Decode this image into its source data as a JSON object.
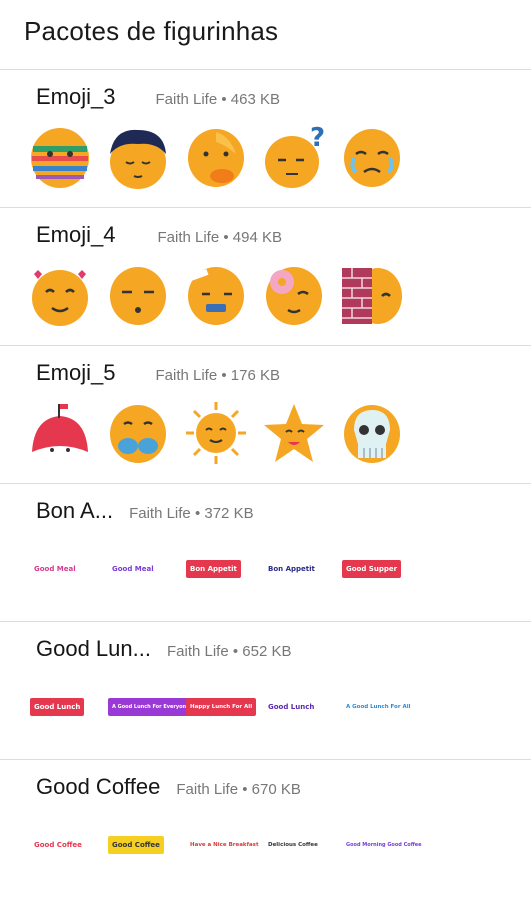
{
  "header": {
    "title": "Pacotes de figurinhas"
  },
  "colors": {
    "emoji_face": "#f5a623",
    "divider": "#dddddd",
    "meta_text": "#777777"
  },
  "packs": [
    {
      "name": "Emoji_3",
      "publisher": "Faith Life",
      "size": "463 KB",
      "stickers": [
        "emoji-easter-egg",
        "emoji-hair",
        "emoji-duck-beak",
        "emoji-question",
        "emoji-crying"
      ]
    },
    {
      "name": "Emoji_4",
      "publisher": "Faith Life",
      "size": "494 KB",
      "stickers": [
        "emoji-hearts",
        "emoji-sleepy",
        "emoji-bandage",
        "emoji-donut",
        "emoji-brick-wall"
      ]
    },
    {
      "name": "Emoji_5",
      "publisher": "Faith Life",
      "size": "176 KB",
      "stickers": [
        "emoji-cake",
        "emoji-bikini",
        "emoji-sun",
        "emoji-star",
        "emoji-skull"
      ]
    },
    {
      "name": "Bon A...",
      "publisher": "Faith Life",
      "size": "372 KB",
      "stickers": [
        "Good Meal",
        "Good Meal",
        "Bon Appetit",
        "Bon Appetit",
        "Good Supper"
      ]
    },
    {
      "name": "Good Lun...",
      "publisher": "Faith Life",
      "size": "652 KB",
      "stickers": [
        "Good Lunch",
        "A Good Lunch For Everyone",
        "Happy Lunch For All",
        "Good Lunch",
        "A Good Lunch For All"
      ]
    },
    {
      "name": "Good Coffee",
      "publisher": "Faith Life",
      "size": "670 KB",
      "stickers": [
        "Good Coffee",
        "Good Coffee",
        "Have a Nice Breakfast",
        "Delicious Coffee",
        "Good Morning Good Coffee"
      ]
    }
  ],
  "separator": "•"
}
